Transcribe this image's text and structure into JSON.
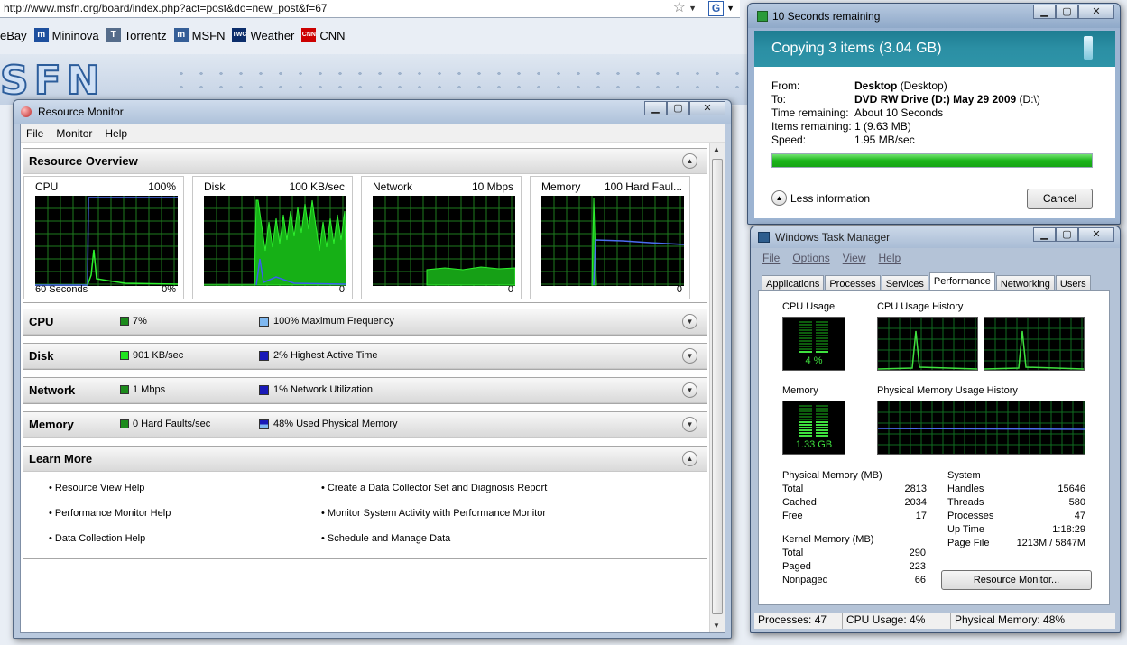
{
  "browser": {
    "url": "http://www.msfn.org/board/index.php?act=post&do=new_post&f=67",
    "bookmarks": [
      {
        "label": "eBay",
        "icon": "ebay-icon",
        "color": "#ffffff"
      },
      {
        "label": "Mininova",
        "icon": "mininova-icon",
        "color": "#1d4f9e"
      },
      {
        "label": "Torrentz",
        "icon": "torrentz-icon",
        "color": "#556c8a"
      },
      {
        "label": "MSFN",
        "icon": "msfn-icon",
        "color": "#355e97"
      },
      {
        "label": "Weather",
        "icon": "weather-icon",
        "color": "#0b2d6b"
      },
      {
        "label": "CNN",
        "icon": "cnn-icon",
        "color": "#cc0000"
      }
    ],
    "logo": "SFN"
  },
  "resource_monitor": {
    "title": "Resource Monitor",
    "menu": [
      "File",
      "Monitor",
      "Help"
    ],
    "overview": {
      "title": "Resource Overview",
      "graphs": [
        {
          "name": "CPU",
          "scale": "100%",
          "bottom_left": "60 Seconds",
          "bottom_right": "0%"
        },
        {
          "name": "Disk",
          "scale": "100 KB/sec",
          "bottom_left": "",
          "bottom_right": "0"
        },
        {
          "name": "Network",
          "scale": "10 Mbps",
          "bottom_left": "",
          "bottom_right": "0"
        },
        {
          "name": "Memory",
          "scale": "100 Hard Faul...",
          "bottom_left": "",
          "bottom_right": "0"
        }
      ]
    },
    "sections": [
      {
        "title": "CPU",
        "value1": "7%",
        "value2": "100% Maximum Frequency",
        "key1_color": "#1c8b1c",
        "key2_color": "#7fb8f0"
      },
      {
        "title": "Disk",
        "value1": "901 KB/sec",
        "value2": "2% Highest Active Time",
        "key1_color": "#1fe41f",
        "key2_color": "#1a1ab8"
      },
      {
        "title": "Network",
        "value1": "1 Mbps",
        "value2": "1% Network Utilization",
        "key1_color": "#1c8b1c",
        "key2_color": "#1a1ab8"
      },
      {
        "title": "Memory",
        "value1": "0 Hard Faults/sec",
        "value2": "48% Used Physical Memory",
        "key1_color": "#1c8b1c",
        "key2_color": "#1a1ab8"
      }
    ],
    "learn_more": {
      "title": "Learn More",
      "left_links": [
        "Resource View Help",
        "Performance Monitor Help",
        "Data Collection Help"
      ],
      "right_links": [
        "Create a Data Collector Set and Diagnosis Report",
        "Monitor System Activity with Performance Monitor",
        "Schedule and Manage Data"
      ]
    }
  },
  "copy_dialog": {
    "title": "10 Seconds remaining",
    "heading": "Copying 3 items (3.04 GB)",
    "from_label": "From:",
    "from_bold": "Desktop",
    "from_rest": "(Desktop)",
    "to_label": "To:",
    "to_bold": "DVD RW Drive (D:) May 29 2009",
    "to_rest": "(D:\\)",
    "time_label": "Time remaining:",
    "time_value": "About 10 Seconds",
    "items_label": "Items remaining:",
    "items_value": "1 (9.63 MB)",
    "speed_label": "Speed:",
    "speed_value": "1.95 MB/sec",
    "progress": 1.0,
    "less_info": "Less information",
    "cancel": "Cancel"
  },
  "task_manager": {
    "title": "Windows Task Manager",
    "menu": [
      "File",
      "Options",
      "View",
      "Help"
    ],
    "tabs": [
      "Applications",
      "Processes",
      "Services",
      "Performance",
      "Networking",
      "Users"
    ],
    "active_tab": "Performance",
    "cpu_usage_label": "CPU Usage",
    "cpu_usage_value": "4 %",
    "cpu_history_label": "CPU Usage History",
    "memory_label": "Memory",
    "memory_value": "1.33 GB",
    "mem_history_label": "Physical Memory Usage History",
    "physical_memory": {
      "title": "Physical Memory (MB)",
      "rows": [
        [
          "Total",
          "2813"
        ],
        [
          "Cached",
          "2034"
        ],
        [
          "Free",
          "17"
        ]
      ]
    },
    "kernel_memory": {
      "title": "Kernel Memory (MB)",
      "rows": [
        [
          "Total",
          "290"
        ],
        [
          "Paged",
          "223"
        ],
        [
          "Nonpaged",
          "66"
        ]
      ]
    },
    "system": {
      "title": "System",
      "rows": [
        [
          "Handles",
          "15646"
        ],
        [
          "Threads",
          "580"
        ],
        [
          "Processes",
          "47"
        ],
        [
          "Up Time",
          "1:18:29"
        ],
        [
          "Page File",
          "1213M / 5847M"
        ]
      ]
    },
    "resource_monitor_button": "Resource Monitor...",
    "status": {
      "processes": "Processes: 47",
      "cpu": "CPU Usage: 4%",
      "memory": "Physical Memory: 48%"
    }
  }
}
